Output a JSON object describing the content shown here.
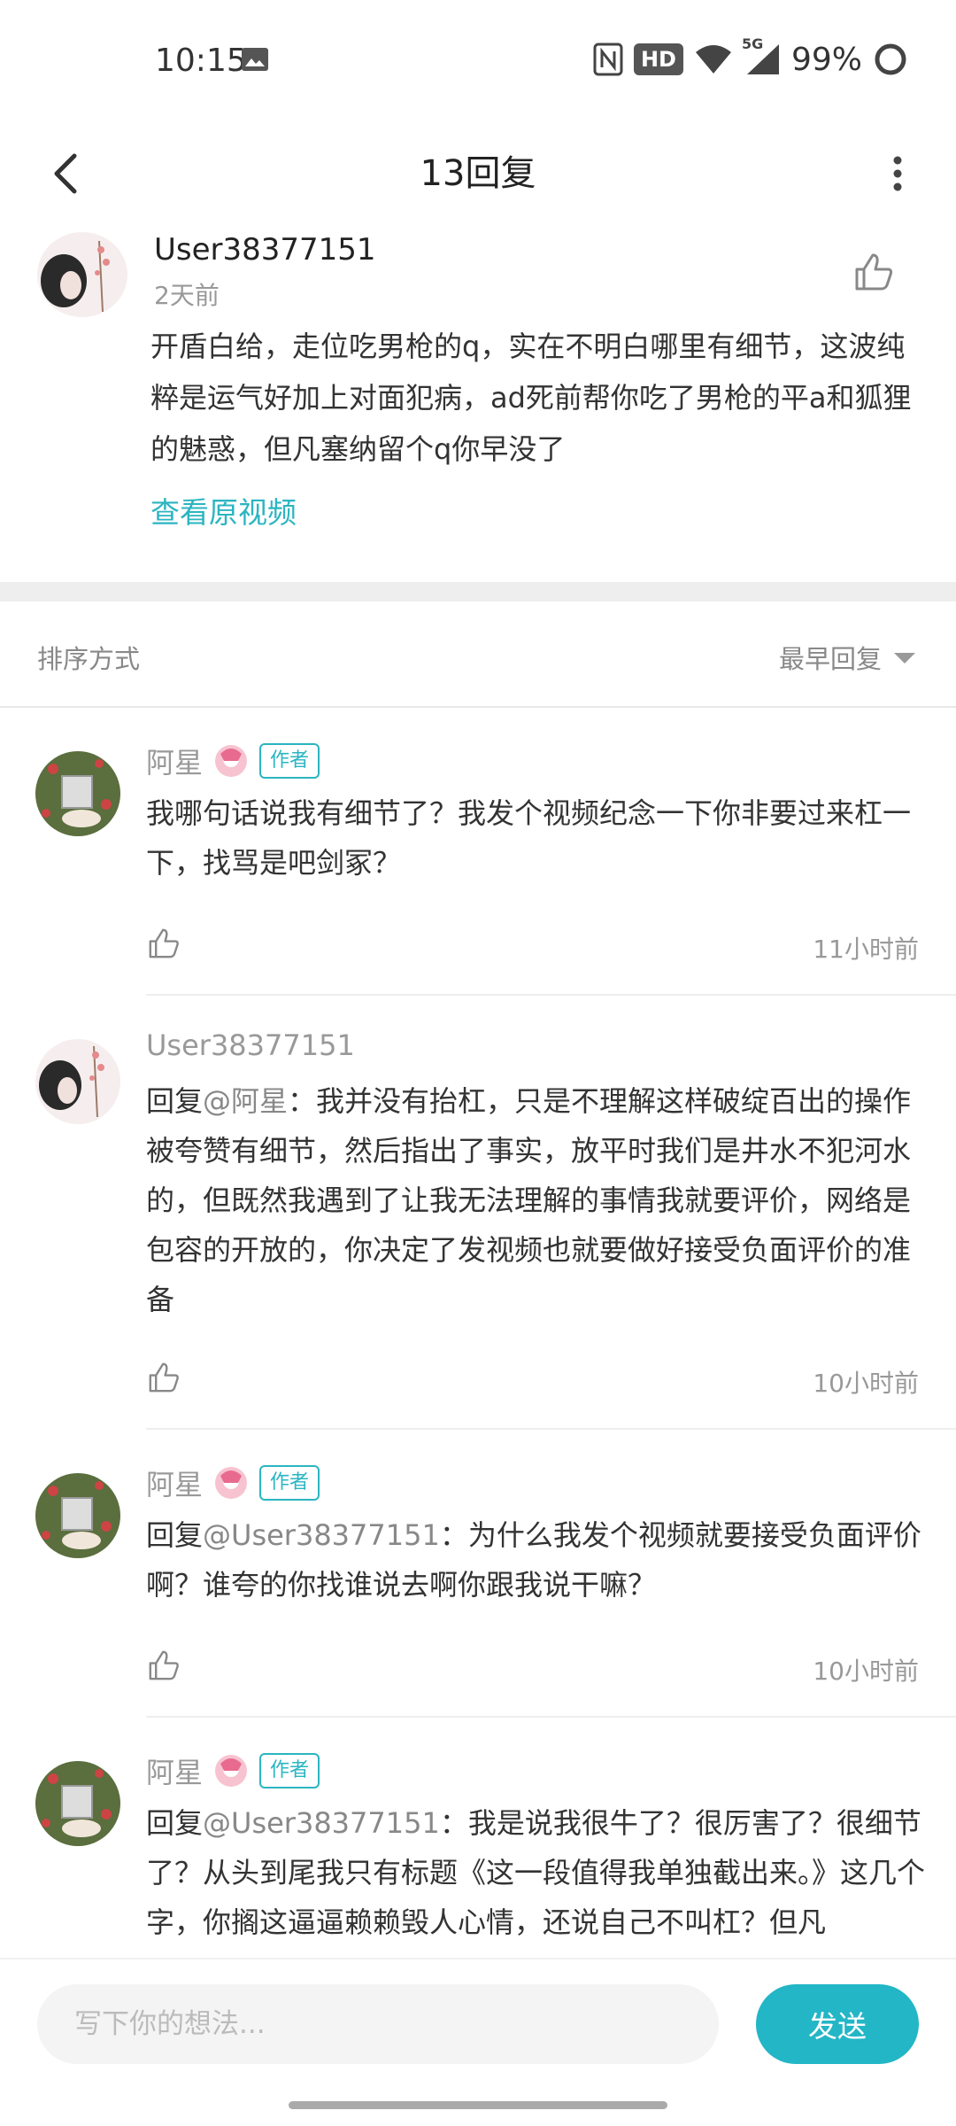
{
  "status_bar": {
    "time": "10:15",
    "battery": "99%",
    "icons": [
      "image-icon",
      "nfc-icon",
      "hd-icon",
      "wifi-icon",
      "5g-signal-icon",
      "battery-ring-icon"
    ],
    "hd_label": "HD",
    "network_label": "5G"
  },
  "header": {
    "title": "13回复",
    "back_icon": "chevron-left-icon",
    "more_icon": "vertical-dots-icon"
  },
  "main_comment": {
    "user": "User38377151",
    "time": "2天前",
    "text": "开盾白给，走位吃男枪的q，实在不明白哪里有细节，这波纯粹是运气好加上对面犯病，ad死前帮你吃了男枪的平a和狐狸的魅惑，但凡塞纳留个q你早没了",
    "link": "查看原视频"
  },
  "sort": {
    "label": "排序方式",
    "value": "最早回复"
  },
  "replies": [
    {
      "name": "阿星",
      "badge": "作者",
      "mention": "",
      "prefix": "",
      "text": "我哪句话说我有细节了？我发个视频纪念一下你非要过来杠一下，找骂是吧剑冢？",
      "time": "11小时前"
    },
    {
      "name": "User38377151",
      "badge": "",
      "prefix": "回复",
      "mention": "@阿星",
      "text": "：我并没有抬杠，只是不理解这样破绽百出的操作被夸赞有细节，然后指出了事实，放平时我们是井水不犯河水的，但既然我遇到了让我无法理解的事情我就要评价，网络是包容的开放的，你决定了发视频也就要做好接受负面评价的准备",
      "time": "10小时前"
    },
    {
      "name": "阿星",
      "badge": "作者",
      "prefix": "回复",
      "mention": "@User38377151",
      "text": "：为什么我发个视频就要接受负面评价啊？谁夸的你找谁说去啊你跟我说干嘛？",
      "time": "10小时前"
    },
    {
      "name": "阿星",
      "badge": "作者",
      "prefix": "回复",
      "mention": "@User38377151",
      "text": "：我是说我很牛了？很厉害了？很细节了？从头到尾我只有标题《这一段值得我单独截出来。》这几个字，你搁这逼逼赖赖毁人心情，还说自己不叫杠？但凡",
      "time": ""
    }
  ],
  "composer": {
    "placeholder": "写下你的想法...",
    "send_label": "发送"
  },
  "colors": {
    "accent": "#22b6c6",
    "link": "#2bb5c1",
    "muted": "#999999"
  }
}
